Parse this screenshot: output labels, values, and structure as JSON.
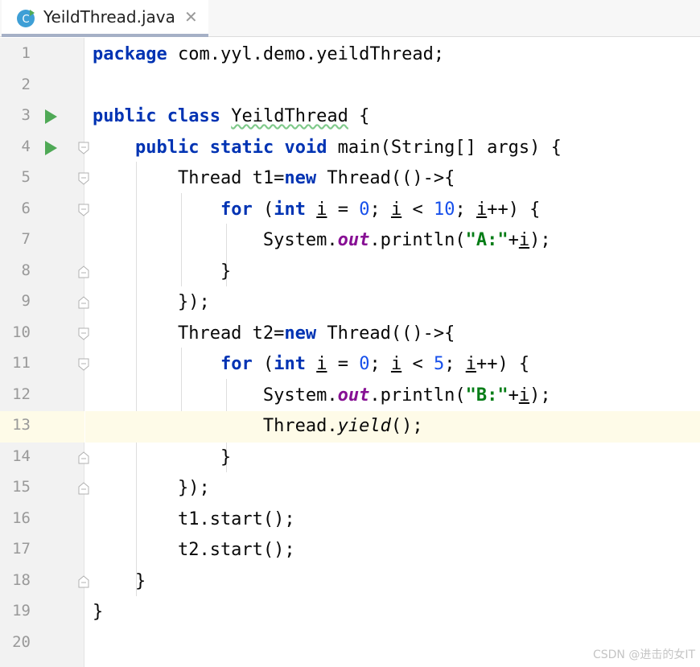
{
  "tab": {
    "filename": "YeildThread.java",
    "icon": "java-class-icon",
    "close": "✕"
  },
  "lines": [
    {
      "n": "1",
      "run": false,
      "fold": "none",
      "parts": [
        [
          "kw",
          "package"
        ],
        [
          "",
          " com.yyl.demo.yeildThread;"
        ]
      ]
    },
    {
      "n": "2",
      "run": false,
      "fold": "none",
      "parts": []
    },
    {
      "n": "3",
      "run": true,
      "fold": "none",
      "parts": [
        [
          "kw",
          "public"
        ],
        [
          "",
          " "
        ],
        [
          "kw",
          "class"
        ],
        [
          "",
          " "
        ],
        [
          "wavy",
          "YeildThread"
        ],
        [
          "",
          " {"
        ]
      ]
    },
    {
      "n": "4",
      "run": true,
      "fold": "open",
      "parts": [
        [
          "",
          "    "
        ],
        [
          "kw",
          "public"
        ],
        [
          "",
          " "
        ],
        [
          "kw",
          "static"
        ],
        [
          "",
          " "
        ],
        [
          "kw",
          "void"
        ],
        [
          "",
          " main(String[] args) {"
        ]
      ]
    },
    {
      "n": "5",
      "run": false,
      "fold": "open",
      "parts": [
        [
          "",
          "        Thread t1="
        ],
        [
          "kw",
          "new"
        ],
        [
          "",
          " Thread(()->{"
        ]
      ]
    },
    {
      "n": "6",
      "run": false,
      "fold": "open",
      "parts": [
        [
          "",
          "            "
        ],
        [
          "kw",
          "for"
        ],
        [
          "",
          " ("
        ],
        [
          "kw",
          "int"
        ],
        [
          "",
          " "
        ],
        [
          "under",
          "i"
        ],
        [
          "",
          " = "
        ],
        [
          "num",
          "0"
        ],
        [
          "",
          "; "
        ],
        [
          "under",
          "i"
        ],
        [
          "",
          " < "
        ],
        [
          "num",
          "10"
        ],
        [
          "",
          "; "
        ],
        [
          "under",
          "i"
        ],
        [
          "",
          "++) {"
        ]
      ]
    },
    {
      "n": "7",
      "run": false,
      "fold": "none",
      "parts": [
        [
          "",
          "                System."
        ],
        [
          "fld",
          "out"
        ],
        [
          "",
          ".println("
        ],
        [
          "str",
          "\"A:\""
        ],
        [
          "",
          "+"
        ],
        [
          "under",
          "i"
        ],
        [
          "",
          ");"
        ]
      ]
    },
    {
      "n": "8",
      "run": false,
      "fold": "close",
      "parts": [
        [
          "",
          "            }"
        ]
      ]
    },
    {
      "n": "9",
      "run": false,
      "fold": "close",
      "parts": [
        [
          "",
          "        });"
        ]
      ]
    },
    {
      "n": "10",
      "run": false,
      "fold": "open",
      "parts": [
        [
          "",
          "        Thread t2="
        ],
        [
          "kw",
          "new"
        ],
        [
          "",
          " Thread(()->{"
        ]
      ]
    },
    {
      "n": "11",
      "run": false,
      "fold": "open",
      "parts": [
        [
          "",
          "            "
        ],
        [
          "kw",
          "for"
        ],
        [
          "",
          " ("
        ],
        [
          "kw",
          "int"
        ],
        [
          "",
          " "
        ],
        [
          "under",
          "i"
        ],
        [
          "",
          " = "
        ],
        [
          "num",
          "0"
        ],
        [
          "",
          "; "
        ],
        [
          "under",
          "i"
        ],
        [
          "",
          " < "
        ],
        [
          "num",
          "5"
        ],
        [
          "",
          "; "
        ],
        [
          "under",
          "i"
        ],
        [
          "",
          "++) {"
        ]
      ]
    },
    {
      "n": "12",
      "run": false,
      "fold": "none",
      "parts": [
        [
          "",
          "                System."
        ],
        [
          "fld",
          "out"
        ],
        [
          "",
          ".println("
        ],
        [
          "str",
          "\"B:\""
        ],
        [
          "",
          "+"
        ],
        [
          "under",
          "i"
        ],
        [
          "",
          ");"
        ]
      ]
    },
    {
      "n": "13",
      "run": false,
      "fold": "none",
      "current": true,
      "parts": [
        [
          "",
          "                Thread."
        ],
        [
          "ital",
          "yield"
        ],
        [
          "",
          "();"
        ]
      ]
    },
    {
      "n": "14",
      "run": false,
      "fold": "close",
      "parts": [
        [
          "",
          "            }"
        ]
      ]
    },
    {
      "n": "15",
      "run": false,
      "fold": "close",
      "parts": [
        [
          "",
          "        });"
        ]
      ]
    },
    {
      "n": "16",
      "run": false,
      "fold": "none",
      "parts": [
        [
          "",
          "        t1.start();"
        ]
      ]
    },
    {
      "n": "17",
      "run": false,
      "fold": "none",
      "parts": [
        [
          "",
          "        t2.start();"
        ]
      ]
    },
    {
      "n": "18",
      "run": false,
      "fold": "close",
      "parts": [
        [
          "",
          "    }"
        ]
      ]
    },
    {
      "n": "19",
      "run": false,
      "fold": "none",
      "parts": [
        [
          "",
          "}"
        ]
      ]
    },
    {
      "n": "20",
      "run": false,
      "fold": "none",
      "parts": []
    }
  ],
  "watermark": "CSDN @进击的女IT",
  "colors": {
    "keyword": "#0033b3",
    "number": "#1750eb",
    "string": "#067d17",
    "field": "#871094",
    "current_line": "#fefbe8",
    "run_icon": "#4fa956"
  }
}
